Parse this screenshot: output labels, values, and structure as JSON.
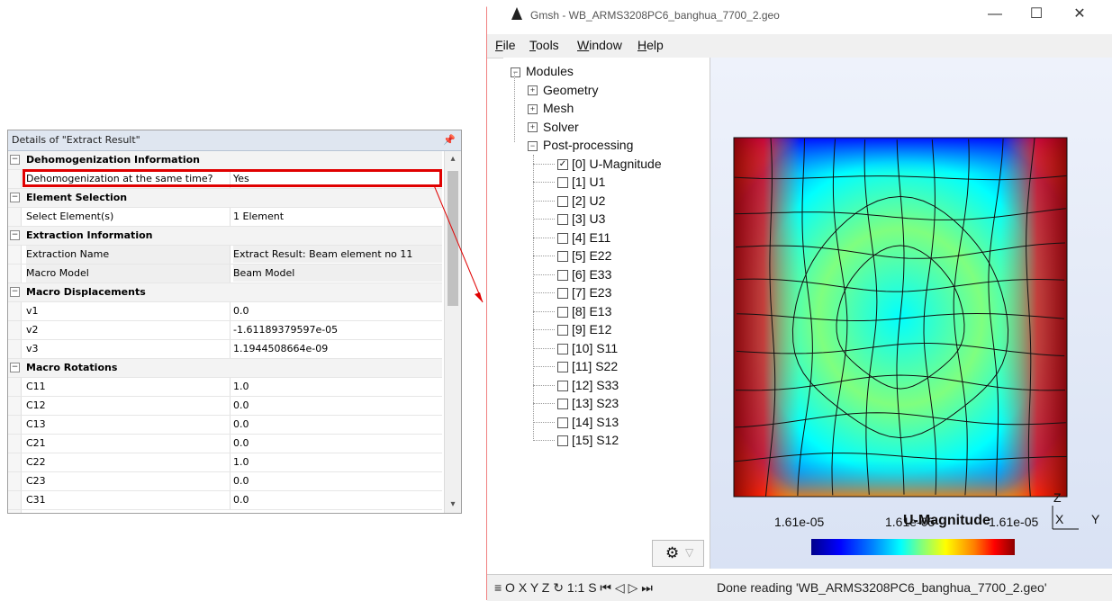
{
  "details_panel": {
    "title": "Details of \"Extract Result\"",
    "pin_icon": "pin-icon",
    "sections": [
      {
        "category": "Dehomogenization Information",
        "rows": [
          {
            "key": "Dehomogenization at the same time?",
            "value": "Yes",
            "highlighted": true
          }
        ]
      },
      {
        "category": "Element Selection",
        "rows": [
          {
            "key": "Select Element(s)",
            "value": "1 Element"
          }
        ]
      },
      {
        "category": "Extraction Information",
        "rows": [
          {
            "key": "Extraction Name",
            "value": "Extract Result: Beam element no 11",
            "shaded": true
          },
          {
            "key": "Macro Model",
            "value": "Beam Model",
            "shaded": true
          }
        ]
      },
      {
        "category": "Macro Displacements",
        "rows": [
          {
            "key": "v1",
            "value": "0.0"
          },
          {
            "key": "v2",
            "value": "-1.61189379597e-05"
          },
          {
            "key": "v3",
            "value": "1.1944508664e-09"
          }
        ]
      },
      {
        "category": "Macro Rotations",
        "rows": [
          {
            "key": "C11",
            "value": "1.0"
          },
          {
            "key": "C12",
            "value": "0.0"
          },
          {
            "key": "C13",
            "value": "0.0"
          },
          {
            "key": "C21",
            "value": "0.0"
          },
          {
            "key": "C22",
            "value": "1.0"
          },
          {
            "key": "C23",
            "value": "0.0"
          },
          {
            "key": "C31",
            "value": "0.0"
          }
        ]
      }
    ],
    "highlight_color": "#e00000"
  },
  "gmsh": {
    "title": "Gmsh - WB_ARMS3208PC6_banghua_7700_2.geo",
    "window_buttons": {
      "minimize": "—",
      "maximize": "☐",
      "close": "✕"
    },
    "menu": [
      "File",
      "Tools",
      "Window",
      "Help"
    ],
    "menu_underline": [
      "F",
      "T",
      "W",
      "H"
    ],
    "tree": {
      "root": "Modules",
      "modules": [
        "Geometry",
        "Mesh",
        "Solver"
      ],
      "post": "Post-processing",
      "views": [
        {
          "label": "[0] U-Magnitude",
          "checked": true
        },
        {
          "label": "[1] U1",
          "checked": false
        },
        {
          "label": "[2] U2",
          "checked": false
        },
        {
          "label": "[3] U3",
          "checked": false
        },
        {
          "label": "[4] E11",
          "checked": false
        },
        {
          "label": "[5] E22",
          "checked": false
        },
        {
          "label": "[6] E33",
          "checked": false
        },
        {
          "label": "[7] E23",
          "checked": false
        },
        {
          "label": "[8] E13",
          "checked": false
        },
        {
          "label": "[9] E12",
          "checked": false
        },
        {
          "label": "[10] S11",
          "checked": false
        },
        {
          "label": "[11] S22",
          "checked": false
        },
        {
          "label": "[12] S33",
          "checked": false
        },
        {
          "label": "[13] S23",
          "checked": false
        },
        {
          "label": "[14] S13",
          "checked": false
        },
        {
          "label": "[15] S12",
          "checked": false
        }
      ]
    },
    "gear_button": {
      "icon": "gear-icon",
      "caret": "▽"
    },
    "plot": {
      "scale_title": "U-Magnitude",
      "scale_labels": [
        "1.61e-05",
        "1.61e-05",
        "1.61e-05"
      ],
      "colormap": [
        "#00008b",
        "#0000ff",
        "#0080ff",
        "#00ffff",
        "#7fff7f",
        "#ffff00",
        "#ff8000",
        "#ff0000",
        "#8b0000"
      ],
      "axes": {
        "z": "Z",
        "x": "X",
        "y": "Y"
      }
    },
    "statusbar": {
      "controls": "≡ O X Y Z ↻ 1:1 S ⏮ ◁ ▷ ⏭",
      "message": "Done reading 'WB_ARMS3208PC6_banghua_7700_2.geo'"
    }
  }
}
